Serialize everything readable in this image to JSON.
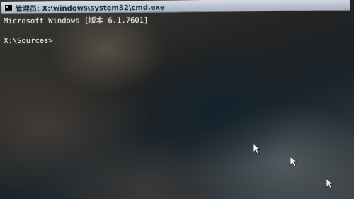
{
  "window": {
    "title": "管理员: X:\\windows\\system32\\cmd.exe",
    "icon": "cmd-icon"
  },
  "console": {
    "lines": [
      "Microsoft Windows [版本 6.1.7601]",
      "",
      "X:\\Sources>"
    ]
  },
  "cursors": [
    {
      "icon": "mouse-pointer-icon"
    },
    {
      "icon": "mouse-pointer-icon"
    },
    {
      "icon": "mouse-pointer-icon"
    }
  ]
}
